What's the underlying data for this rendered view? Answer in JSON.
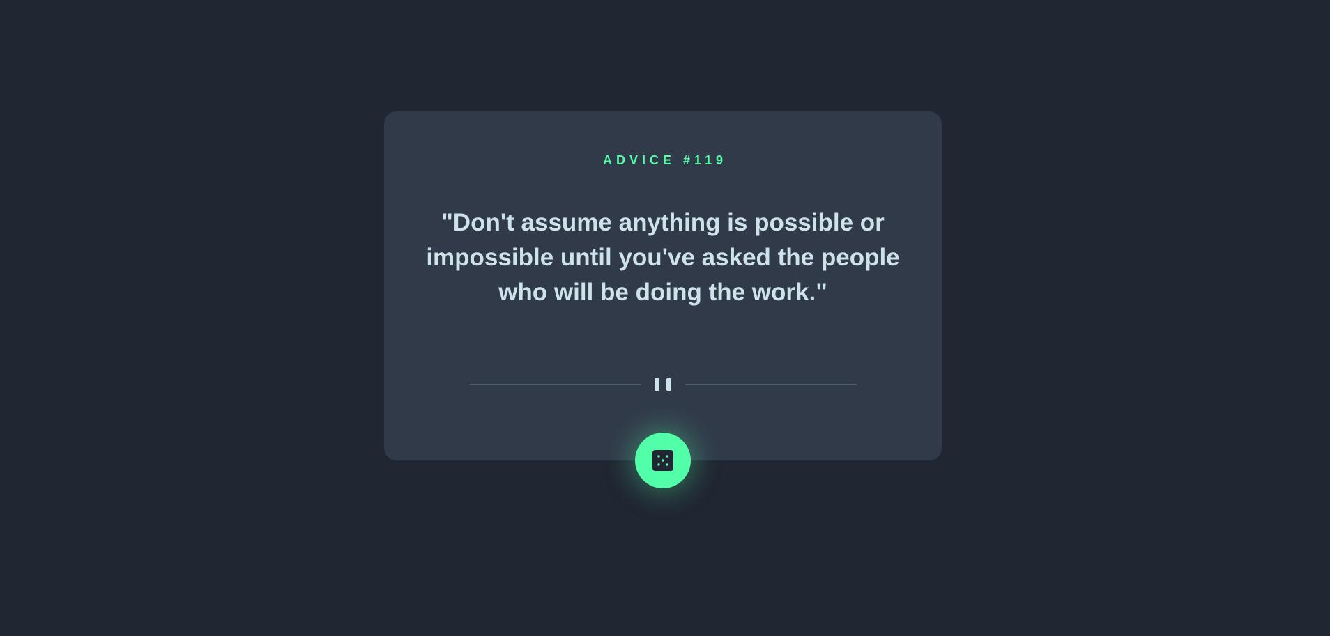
{
  "card": {
    "advice_label": "ADVICE #119",
    "quote": "\"Don't assume anything is possible or impossible until you've asked the people who will be doing the work.\""
  },
  "colors": {
    "accent": "#52ffa8",
    "background": "#202632",
    "card": "#313a49",
    "text": "#cee3e9",
    "divider": "#4f5d74"
  },
  "icons": {
    "divider_icon": "pause-icon",
    "button_icon": "dice-icon"
  }
}
